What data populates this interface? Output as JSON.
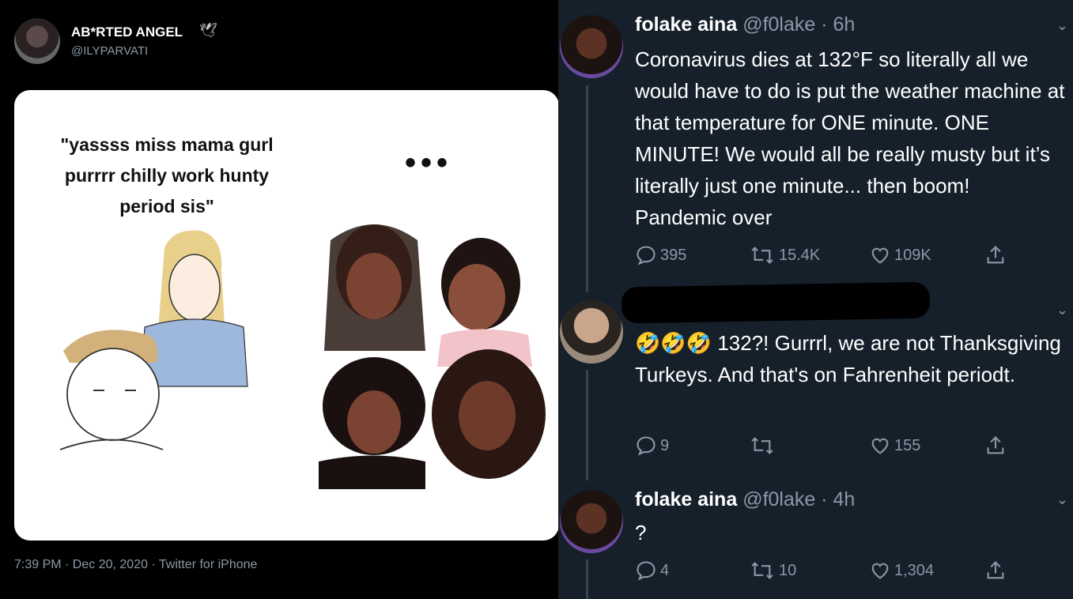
{
  "left_tweet": {
    "display_name": "AB*RTED ANGEL",
    "badge_icon": "dove-icon",
    "handle": "@ILYPARVATI",
    "meme_quote": "\"yassss miss mama gurl purrrr chilly work hunty period sis\"",
    "meme_ellipsis": "•••",
    "timestamp": "7:39 PM · Dec 20, 2020 · Twitter for iPhone"
  },
  "right_tweets": [
    {
      "display_name": "folake aina",
      "meta": "@f0lake · 6h",
      "body": "Coronavirus dies at 132°F so literally all we would have to do is put the weather machine at that temperature for ONE minute. ONE MINUTE! We would all be really musty but it’s literally just one minute... then boom! Pandemic over",
      "replies": "395",
      "retweets": "15.4K",
      "likes": "109K"
    },
    {
      "display_name": "",
      "meta": "",
      "body": "🤣🤣🤣 132?! Gurrrl, we are not Thanksgiving Turkeys. And that's on Fahrenheit periodt.",
      "replies": "9",
      "retweets": "",
      "likes": "155"
    },
    {
      "display_name": "folake aina",
      "meta": "@f0lake · 4h",
      "body": "?",
      "replies": "4",
      "retweets": "10",
      "likes": "1,304"
    }
  ],
  "colors": {
    "dark_bg": "#15202b",
    "muted": "#8b98a5",
    "thread_line": "#38444d"
  }
}
